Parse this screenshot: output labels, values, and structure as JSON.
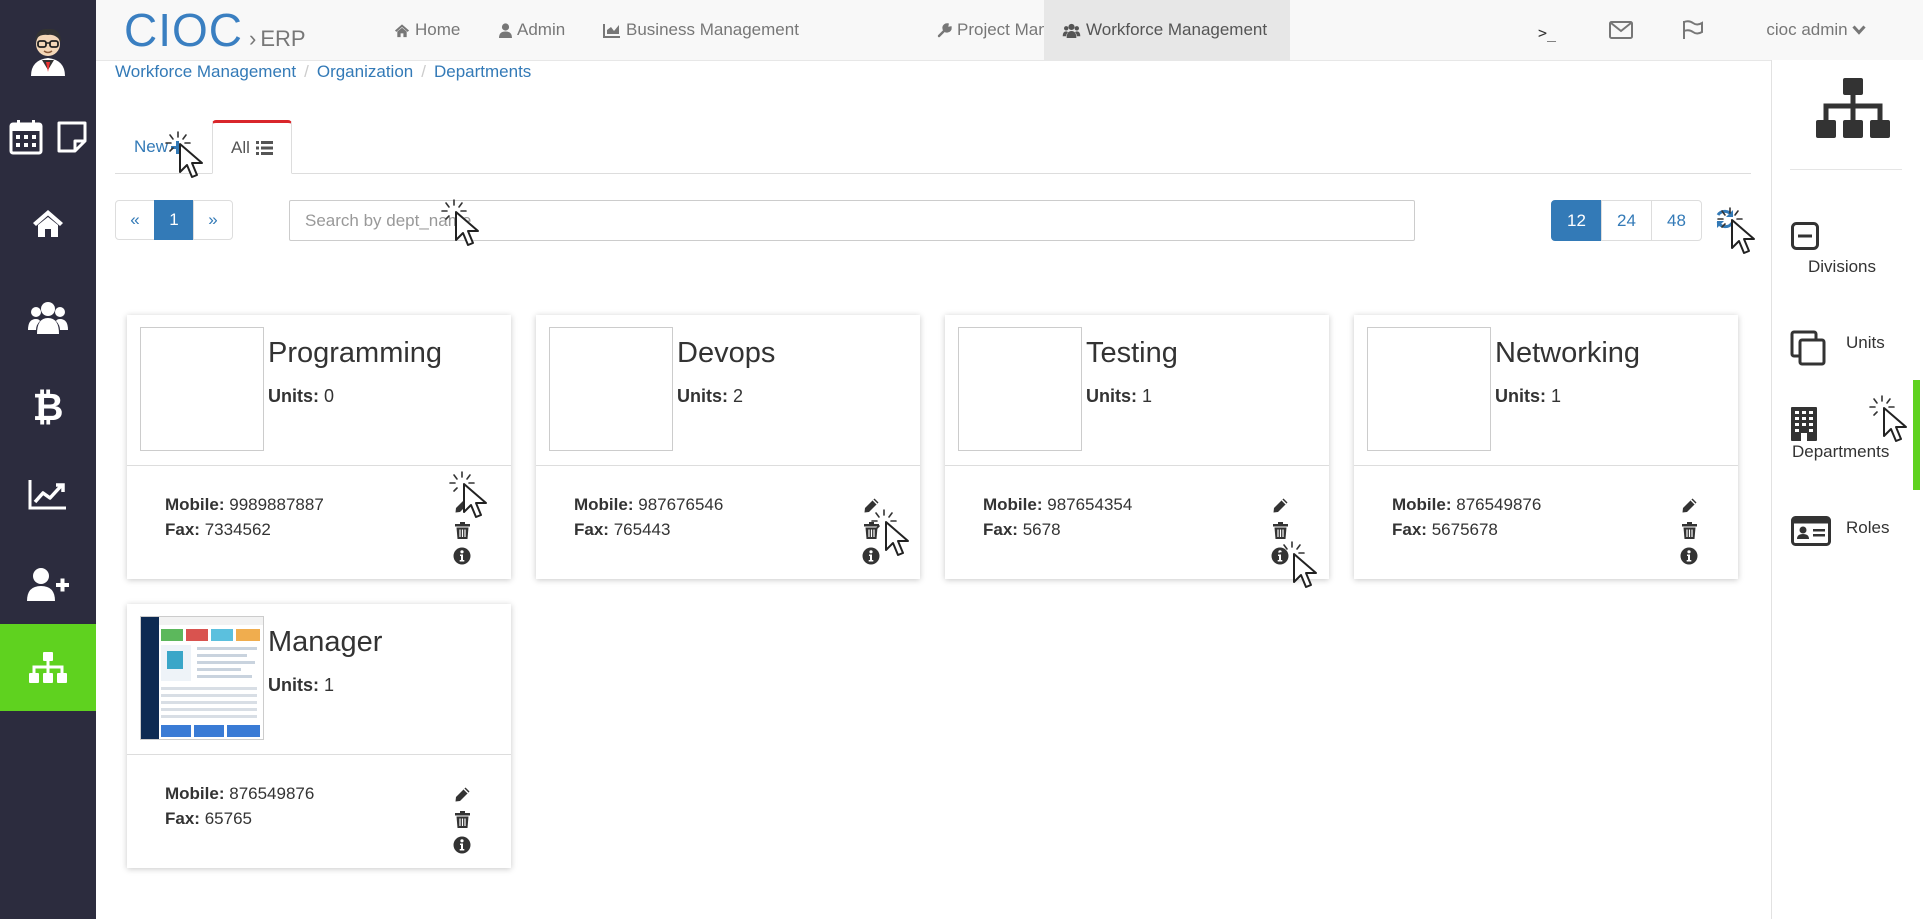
{
  "brand": {
    "name": "CIOC",
    "separator": "›",
    "sub": "ERP"
  },
  "nav": {
    "items": [
      {
        "label": "Home",
        "icon": "home-icon"
      },
      {
        "label": "Admin",
        "icon": "user-icon"
      },
      {
        "label": "Business Management",
        "icon": "chart-icon"
      },
      {
        "label": "Project Management",
        "icon": "wrench-icon"
      },
      {
        "label": "Workforce Management",
        "icon": "users-icon",
        "active": true
      }
    ],
    "terminal": ">_",
    "user_label": "cioc admin"
  },
  "breadcrumb": [
    "Workforce Management",
    "Organization",
    "Departments"
  ],
  "tabs": {
    "new_label": "New",
    "all_label": "All"
  },
  "pagination": {
    "prev": "«",
    "current": "1",
    "next": "»"
  },
  "search": {
    "placeholder": "Search by dept_name",
    "value": ""
  },
  "per_page": {
    "options": [
      "12",
      "24",
      "48"
    ],
    "selected": "12"
  },
  "labels": {
    "units": "Units:",
    "mobile": "Mobile:",
    "fax": "Fax:"
  },
  "departments": [
    {
      "name": "Programming",
      "units": "0",
      "mobile": "9989887887",
      "fax": "7334562",
      "has_image": false
    },
    {
      "name": "Devops",
      "units": "2",
      "mobile": "987676546",
      "fax": "765443",
      "has_image": false
    },
    {
      "name": "Testing",
      "units": "1",
      "mobile": "987654354",
      "fax": "5678",
      "has_image": false
    },
    {
      "name": "Networking",
      "units": "1",
      "mobile": "876549876",
      "fax": "5675678",
      "has_image": false
    },
    {
      "name": "Manager",
      "units": "1",
      "mobile": "876549876",
      "fax": "65765",
      "has_image": true
    }
  ],
  "right_sidebar": {
    "items": [
      {
        "label": "Divisions",
        "icon": "minus-square-icon"
      },
      {
        "label": "Units",
        "icon": "clone-icon"
      },
      {
        "label": "Departments",
        "icon": "building-icon",
        "active": true
      },
      {
        "label": "Roles",
        "icon": "id-card-icon"
      }
    ]
  },
  "colors": {
    "left_sidebar_bg": "#2c2c3e",
    "accent_green": "#5fd21f",
    "link_blue": "#337ab7",
    "tab_active_border": "#d9262b",
    "brand_blue": "#3a7fc1"
  }
}
